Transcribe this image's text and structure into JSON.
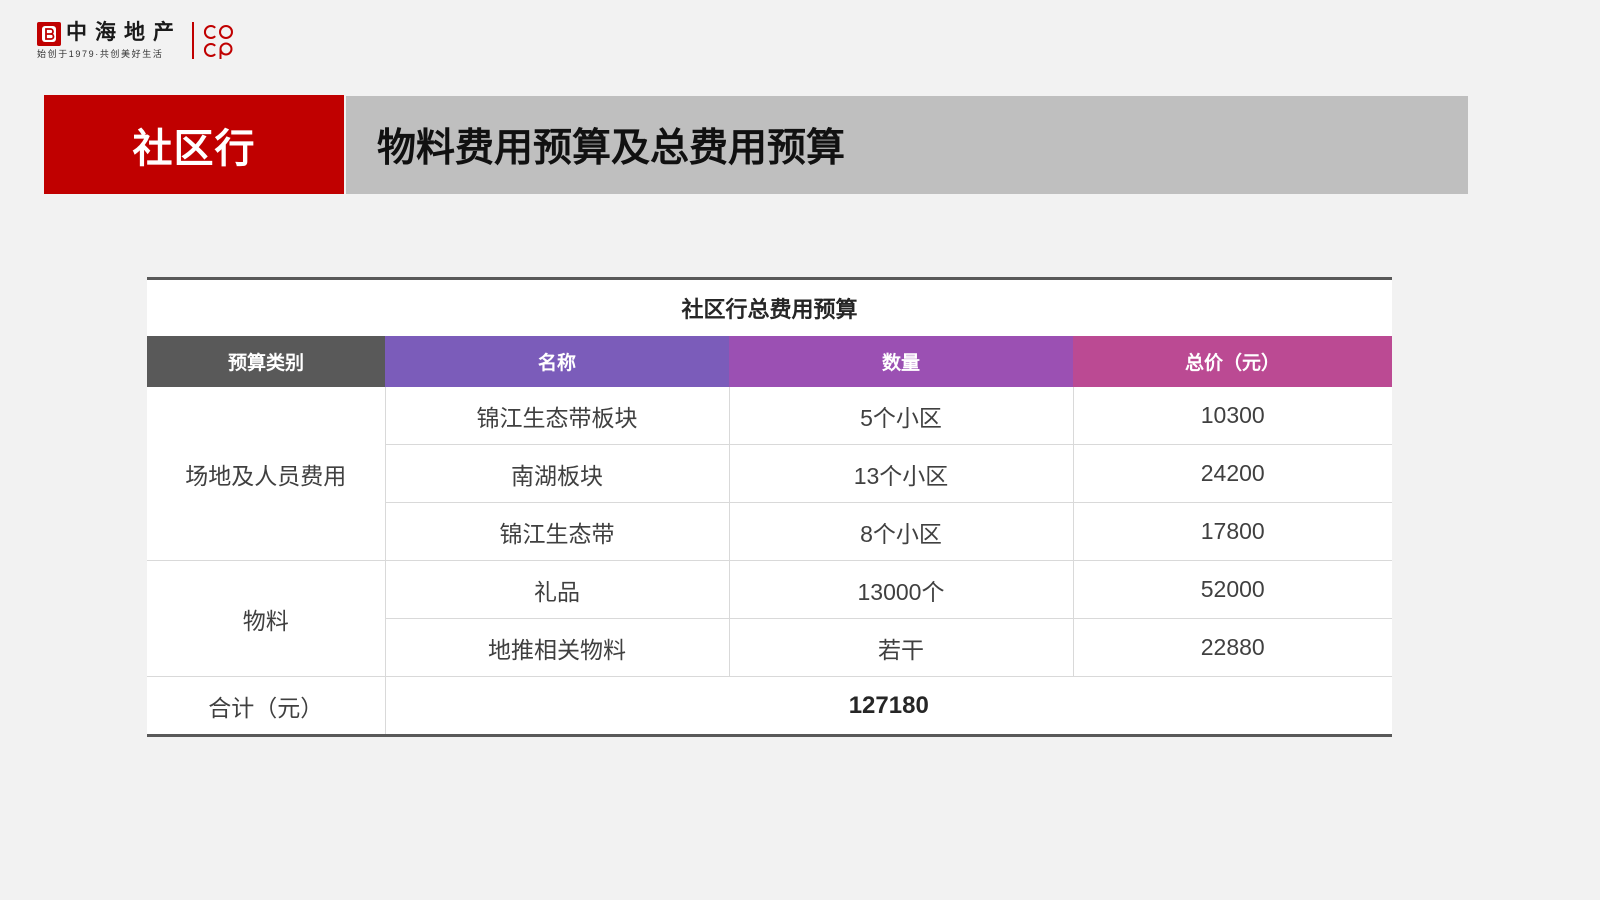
{
  "logo": {
    "brand_name": "中海地产",
    "tagline": "始创于1979·共创美好生活",
    "company_icon": "china-overseas-icon",
    "mark": "coli-logo"
  },
  "header": {
    "section_label": "社区行",
    "title": "物料费用预算及总费用预算"
  },
  "table": {
    "caption": "社区行总费用预算",
    "columns": [
      "预算类别",
      "名称",
      "数量",
      "总价（元）"
    ],
    "groups": [
      {
        "category": "场地及人员费用",
        "rows": [
          {
            "name": "锦江生态带板块",
            "quantity": "5个小区",
            "total": "10300"
          },
          {
            "name": "南湖板块",
            "quantity": "13个小区",
            "total": "24200"
          },
          {
            "name": "锦江生态带",
            "quantity": "8个小区",
            "total": "17800"
          }
        ]
      },
      {
        "category": "物料",
        "rows": [
          {
            "name": "礼品",
            "quantity": "13000个",
            "total": "52000"
          },
          {
            "name": "地推相关物料",
            "quantity": "若干",
            "total": "22880"
          }
        ]
      }
    ],
    "total_label": "合计（元）",
    "total_value": "127180"
  },
  "colors": {
    "page_background": "#f2f2f2",
    "brand_red": "#c00000",
    "title_bar_gray": "#bfbfbf",
    "header_category_bg": "#595959",
    "header_name_bg": "#7b5cba",
    "header_quantity_bg": "#9b50b3",
    "header_total_bg": "#bb4a93",
    "table_rule": "#595959"
  }
}
